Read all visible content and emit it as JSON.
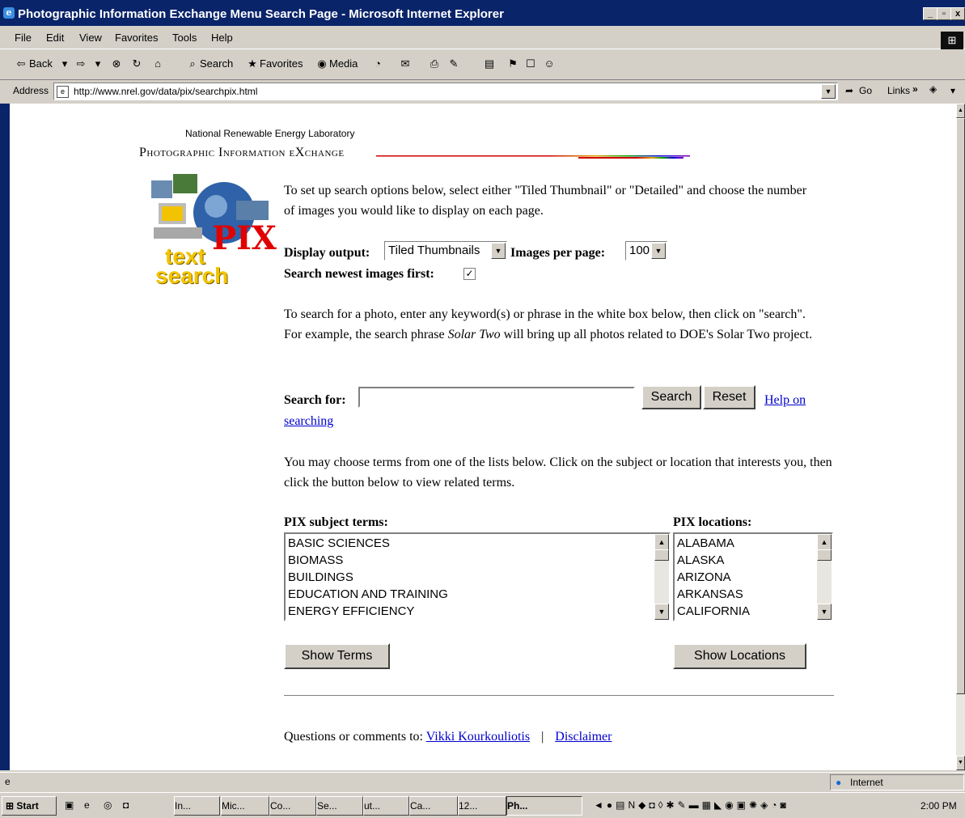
{
  "window": {
    "title": "Photographic Information Exchange Menu Search Page - Microsoft Internet Explorer",
    "controls": [
      "_",
      "▫",
      "x"
    ]
  },
  "menu": [
    "File",
    "Edit",
    "View",
    "Favorites",
    "Tools",
    "Help"
  ],
  "toolbar": {
    "back": "Back",
    "search": "Search",
    "favorites": "Favorites",
    "media": "Media"
  },
  "address": {
    "label": "Address",
    "url": "http://www.nrel.gov/data/pix/searchpix.html",
    "go": "Go",
    "links": "Links"
  },
  "page": {
    "lab_name": "National Renewable Energy Laboratory",
    "pie_title": "Photographic Information eXchange",
    "logo_text": [
      "text",
      "search"
    ],
    "logo_badge": "PIX",
    "intro": "To set up search options below, select either \"Tiled Thumbnail\" or \"Detailed\" and choose the number of images you would like to display on each page.",
    "display_output_label": "Display output:",
    "display_output_value": "Tiled Thumbnails",
    "images_per_page_label": "Images per page:",
    "images_per_page_value": "100",
    "newest_first_label": "Search newest images first:",
    "newest_first_checked": true,
    "search_help_pre": "To search for a photo, enter any keyword(s) or phrase in the white box below, then click on \"search\". For example, the search phrase ",
    "search_help_em": "Solar Two",
    "search_help_post": " will bring up all photos related to DOE's Solar Two project.",
    "search_for_label": "Search for:",
    "search_value": "",
    "search_button": "Search",
    "reset_button": "Reset",
    "help_link_1": "Help on",
    "help_link_2": "searching",
    "lists_intro": "You may choose terms from one of the lists below. Click on the subject or location that interests you, then click the button below to view related terms.",
    "subject_label": "PIX subject terms:",
    "subject_items": [
      "BASIC SCIENCES",
      "BIOMASS",
      "BUILDINGS",
      "EDUCATION AND TRAINING",
      "ENERGY EFFICIENCY"
    ],
    "location_label": "PIX locations:",
    "location_items": [
      "ALABAMA",
      "ALASKA",
      "ARIZONA",
      "ARKANSAS",
      "CALIFORNIA"
    ],
    "show_terms": "Show Terms",
    "show_locations": "Show Locations",
    "contact_pre": "Questions or comments to: ",
    "contact_name": "Vikki Kourkouliotis",
    "separator": "|",
    "disclaimer": "Disclaimer"
  },
  "status": {
    "zone": "Internet"
  },
  "taskbar": {
    "start": "Start",
    "tasks": [
      "In...",
      "Mic...",
      "Co...",
      "Se...",
      "ut...",
      "Ca...",
      "12...",
      "Ph..."
    ],
    "clock": "2:00 PM"
  },
  "colors": {
    "titlebar": "#0a246a",
    "link": "#0000cc",
    "window_face": "#d4d0c8"
  }
}
